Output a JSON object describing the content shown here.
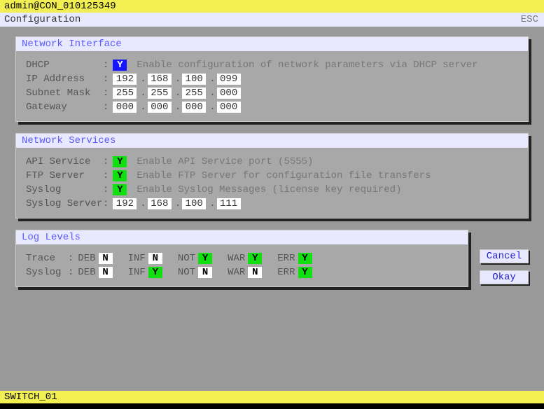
{
  "topbar": {
    "text": "admin@CON_010125349"
  },
  "titlebar": {
    "title": "Configuration",
    "esc": "ESC"
  },
  "sections": {
    "netif": {
      "title": "Network Interface",
      "dhcp": {
        "label": "DHCP",
        "value": "Y",
        "desc": "Enable configuration of network parameters via DHCP server"
      },
      "ip": {
        "label": "IP Address",
        "o1": "192",
        "o2": "168",
        "o3": "100",
        "o4": "099"
      },
      "mask": {
        "label": "Subnet Mask",
        "o1": "255",
        "o2": "255",
        "o3": "255",
        "o4": "000"
      },
      "gw": {
        "label": "Gateway",
        "o1": "000",
        "o2": "000",
        "o3": "000",
        "o4": "000"
      }
    },
    "netsvc": {
      "title": "Network Services",
      "api": {
        "label": "API Service",
        "value": "Y",
        "desc": "Enable API Service port (5555)"
      },
      "ftp": {
        "label": "FTP Server",
        "value": "Y",
        "desc": "Enable FTP Server for configuration file transfers"
      },
      "syslog": {
        "label": "Syslog",
        "value": "Y",
        "desc": "Enable Syslog Messages (license key required)"
      },
      "syslogServer": {
        "label": "Syslog Server",
        "o1": "192",
        "o2": "168",
        "o3": "100",
        "o4": "111"
      }
    },
    "log": {
      "title": "Log Levels",
      "levels": {
        "deb": "DEB",
        "inf": "INF",
        "not": "NOT",
        "war": "WAR",
        "err": "ERR"
      },
      "trace": {
        "label": "Trace",
        "deb": "N",
        "inf": "N",
        "not": "Y",
        "war": "Y",
        "err": "Y"
      },
      "syslog": {
        "label": "Syslog",
        "deb": "N",
        "inf": "Y",
        "not": "N",
        "war": "N",
        "err": "Y"
      }
    }
  },
  "buttons": {
    "cancel": "Cancel",
    "okay": "Okay"
  },
  "bottombar": {
    "text": "SWITCH_01"
  }
}
